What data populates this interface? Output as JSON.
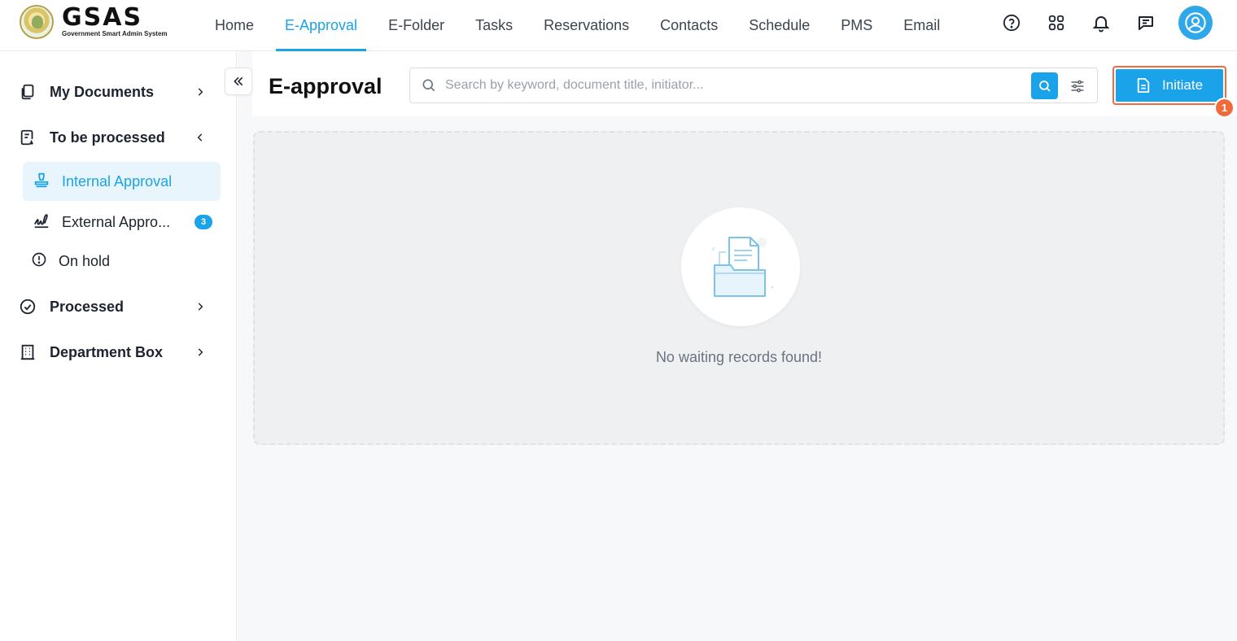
{
  "app": {
    "logo_title": "GSAS",
    "logo_subtitle": "Government Smart Admin System"
  },
  "nav": {
    "items": [
      {
        "label": "Home",
        "active": false
      },
      {
        "label": "E-Approval",
        "active": true
      },
      {
        "label": "E-Folder",
        "active": false
      },
      {
        "label": "Tasks",
        "active": false
      },
      {
        "label": "Reservations",
        "active": false
      },
      {
        "label": "Contacts",
        "active": false
      },
      {
        "label": "Schedule",
        "active": false
      },
      {
        "label": "PMS",
        "active": false
      },
      {
        "label": "Email",
        "active": false
      }
    ]
  },
  "top_icons": [
    "help-icon",
    "apps-grid-icon",
    "bell-icon",
    "chat-icon",
    "user-avatar-icon"
  ],
  "sidebar": {
    "my_documents": "My Documents",
    "to_be_processed": "To be processed",
    "internal_approval": "Internal Approval",
    "external_approval": "External Appro...",
    "external_badge": "3",
    "on_hold": "On hold",
    "processed": "Processed",
    "department_box": "Department Box"
  },
  "main": {
    "title": "E-approval",
    "search_placeholder": "Search by keyword, document title, initiator...",
    "initiate_label": "Initiate",
    "step_badge": "1",
    "empty_message": "No waiting records found!"
  },
  "colors": {
    "accent": "#1aa3e8",
    "highlight": "#f06a3b",
    "active_bg": "#e8f5fd"
  }
}
